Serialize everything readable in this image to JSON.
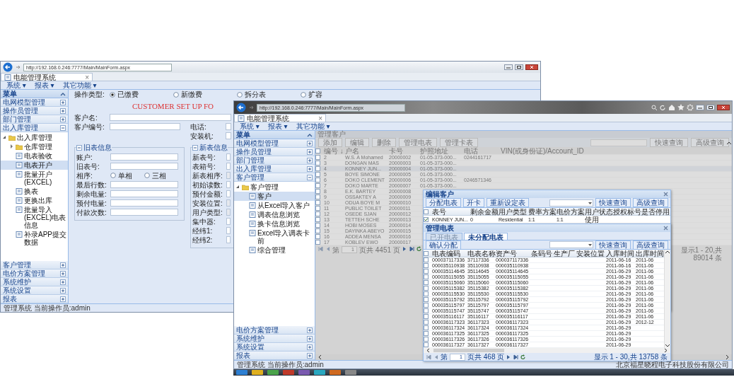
{
  "window_1": {
    "url": "http://192.168.0.246:7777/Main/MainForm.aspx",
    "tab": "电能管理系统",
    "tab_close": "×",
    "menu": [
      "系统 ▾",
      "报表 ▾",
      "其它功能 ▾"
    ],
    "sidebar": {
      "title": "菜单",
      "sections": [
        {
          "label": "电网模型管理",
          "expanded": false
        },
        {
          "label": "操作员管理",
          "expanded": false
        },
        {
          "label": "部门管理",
          "expanded": false
        },
        {
          "label": "出入库管理",
          "expanded": true,
          "tree": [
            {
              "label": "出入库管理",
              "kind": "folder",
              "expanded": true,
              "children": [
                {
                  "label": "仓库管理",
                  "kind": "folder",
                  "expanded": false
                },
                {
                  "label": "电表验收",
                  "kind": "page",
                  "selected": false
                },
                {
                  "label": "电表开户",
                  "kind": "page",
                  "selected": true
                },
                {
                  "label": "批量开户(EXCEL)",
                  "kind": "page",
                  "selected": false
                },
                {
                  "label": "换表",
                  "kind": "page",
                  "selected": false
                },
                {
                  "label": "更换出库",
                  "kind": "page",
                  "selected": false
                },
                {
                  "label": "批量导入(EXCEL)电表信息",
                  "kind": "page",
                  "selected": false
                },
                {
                  "label": "补录APP提交数据",
                  "kind": "page",
                  "selected": false
                }
              ]
            }
          ]
        },
        {
          "label": "客户管理",
          "expanded": false
        },
        {
          "label": "电价方案管理",
          "expanded": false
        },
        {
          "label": "系统维护",
          "expanded": false
        },
        {
          "label": "系统设置",
          "expanded": false
        },
        {
          "label": "报表",
          "expanded": false
        }
      ]
    },
    "status_bar": "管理系统  当前操作员:admin",
    "form": {
      "operation": {
        "label": "操作类型:",
        "options": [
          {
            "label": "已缴费",
            "selected": true
          },
          {
            "label": "新缴费",
            "selected": false
          },
          {
            "label": "拆分表",
            "selected": false
          },
          {
            "label": "扩容",
            "selected": false
          }
        ]
      },
      "title": "CUSTOMER SET UP FO",
      "customer_name": "客户名:",
      "customer_no": "客户编号:",
      "phone": "电话:",
      "installer": "安装机:",
      "old_meter": {
        "legend": "旧表信息",
        "expanded": true,
        "rows": [
          {
            "kind": "field",
            "label": "账户:"
          },
          {
            "kind": "field",
            "label": "旧表号:"
          },
          {
            "kind": "radio",
            "label": "相序:",
            "options": [
              {
                "label": "单相",
                "selected": false
              },
              {
                "label": "三相",
                "selected": false
              }
            ]
          },
          {
            "kind": "field",
            "label": "最后行数:"
          },
          {
            "kind": "field",
            "label": "剩余电量:"
          },
          {
            "kind": "field",
            "label": "预付电量:"
          },
          {
            "kind": "field",
            "label": "付款次数:"
          }
        ]
      },
      "new_meter": {
        "legend": "新表信息",
        "expanded": true,
        "rows": [
          {
            "kind": "field",
            "label": "新表号:"
          },
          {
            "kind": "field",
            "label": "表箱号:"
          },
          {
            "kind": "combo",
            "label": "新表相序:"
          },
          {
            "kind": "field",
            "label": "初始读数:"
          },
          {
            "kind": "field",
            "label": "预付金额:"
          },
          {
            "kind": "combo",
            "label": "安装位置:"
          },
          {
            "kind": "combo",
            "label": "用户类型:"
          },
          {
            "kind": "field",
            "label": "集中器:"
          },
          {
            "kind": "field",
            "label": "经纬1:"
          },
          {
            "kind": "field",
            "label": "经纬2:"
          }
        ]
      }
    }
  },
  "window_2": {
    "url": "http://192.168.0.246:7777/Main/MainForm.aspx",
    "tab": "电能管理系统",
    "tab_close": "×",
    "menu": [
      "系统 ▾",
      "报表 ▾",
      "其它功能 ▾"
    ],
    "sidebar": {
      "title": "菜单",
      "sections": [
        {
          "label": "电网模型管理",
          "expanded": false
        },
        {
          "label": "操作员管理",
          "expanded": false
        },
        {
          "label": "部门管理",
          "expanded": false
        },
        {
          "label": "出入库管理",
          "expanded": false
        },
        {
          "label": "客户管理",
          "expanded": true,
          "tree": [
            {
              "label": "客户管理",
              "kind": "folder",
              "expanded": true,
              "children": [
                {
                  "label": "客户",
                  "kind": "page",
                  "selected": true
                },
                {
                  "label": "从Excel导入客户",
                  "kind": "page",
                  "selected": false
                },
                {
                  "label": "调表信息浏览",
                  "kind": "page",
                  "selected": false
                },
                {
                  "label": "换卡信息浏览",
                  "kind": "page",
                  "selected": false
                },
                {
                  "label": "Excel导入调表卡前",
                  "kind": "page",
                  "selected": false
                },
                {
                  "label": "综合管理",
                  "kind": "page",
                  "selected": false
                }
              ]
            }
          ]
        },
        {
          "label": "电价方案管理",
          "expanded": false
        },
        {
          "label": "系统维护",
          "expanded": false
        },
        {
          "label": "系统设置",
          "expanded": false
        },
        {
          "label": "报表",
          "expanded": false
        }
      ]
    },
    "status_bar": "管理系统  当前操作员:admin",
    "company": "北京福星晓程电子科技股份有限公司",
    "customers": {
      "title": "管理客户",
      "toolbar": [
        "添加",
        "编辑",
        "删除",
        "管理电表",
        "管理卡表"
      ],
      "search_buttons": [
        "快速查询",
        "高级查询"
      ],
      "columns": [
        "编号 ↓",
        "户名",
        "卡号",
        "护照地址",
        "电话",
        "VIN(或身份证)/Account_ID"
      ],
      "rows": [
        {
          "selected": false,
          "cells": [
            "2",
            "W.S. A Mohamed",
            "20000002",
            "01-05-373-000...",
            "0244161717"
          ]
        },
        {
          "selected": false,
          "cells": [
            "3",
            "DONGAN MAS",
            "20000003",
            "01-05-373-000..."
          ]
        },
        {
          "selected": true,
          "cells": [
            "4",
            "KONNEY JUN...",
            "20000004",
            "01-05-373-000..."
          ]
        },
        {
          "selected": false,
          "cells": [
            "5",
            "BOYE SIMONE",
            "20000005",
            "01-05-373-000..."
          ]
        },
        {
          "selected": false,
          "cells": [
            "6",
            "DOKO CLEMENT",
            "20000006",
            "01-05-373-000...",
            "0246571346"
          ]
        },
        {
          "selected": false,
          "cells": [
            "7",
            "DOKO MARTE",
            "20000007",
            "01-05-373-000..."
          ]
        },
        {
          "selected": false,
          "cells": [
            "8",
            "E.K. BARTEY",
            "20000008"
          ]
        },
        {
          "selected": false,
          "cells": [
            "9",
            "OSSAKTEY A",
            "20000009"
          ]
        },
        {
          "selected": false,
          "cells": [
            "10",
            "ODUA BOYE M",
            "20000010"
          ]
        },
        {
          "selected": false,
          "cells": [
            "11",
            "PUBLIC TOILET",
            "20000011"
          ]
        },
        {
          "selected": false,
          "cells": [
            "12",
            "OSEDE SJAN",
            "20000012"
          ]
        },
        {
          "selected": false,
          "cells": [
            "13",
            "TETTEH SCHE",
            "20000013"
          ]
        },
        {
          "selected": false,
          "cells": [
            "14",
            "HOBI MOSES",
            "20000014"
          ]
        },
        {
          "selected": false,
          "cells": [
            "15",
            "DAYINKA ABEYO",
            "20000015"
          ]
        },
        {
          "selected": false,
          "cells": [
            "16",
            "ADDEA MENSA",
            "20000016"
          ]
        },
        {
          "selected": false,
          "cells": [
            "17",
            "KOBLEV EWO",
            "20000017"
          ]
        }
      ],
      "pager": {
        "page_label": "第",
        "page": "1",
        "page_total": "页共 4451 页"
      },
      "summary": "显示1 - 20,共 89014 条"
    }
  },
  "edit_customer_dialog": {
    "title": "编辑客户",
    "toolbar": [
      "分配电表",
      "开卡",
      "重新设定表"
    ],
    "search_buttons": [
      "快速查询",
      "高级查询"
    ],
    "columns": [
      "表号",
      "剩余金额",
      "用户类型",
      "费率方案",
      "电价方案",
      "用户状态",
      "授权标号",
      "是否停用"
    ],
    "rows": [
      {
        "checked": true,
        "cells": [
          "KONNEY JUN...",
          "0",
          "Residential",
          "1:1",
          "1:1",
          "使用"
        ]
      }
    ]
  },
  "meter_dialog": {
    "title": "管理电表",
    "tabs": [
      {
        "label": "已开电表",
        "selected": false
      },
      {
        "label": "未分配电表",
        "selected": true
      }
    ],
    "assign_button": "确认分配",
    "search_buttons": [
      "快速查询",
      "高级查询"
    ],
    "columns": [
      "电表编码",
      "电表名称",
      "资产号",
      "条码号",
      "生产厂",
      "安装位置",
      "入库时间",
      "出库时间"
    ],
    "rows": [
      {
        "checked": false,
        "code": "000037117336",
        "name": "37117336",
        "asset": "000037117336",
        "in_date": "2011-06-16",
        "out_date": "2011-06"
      },
      {
        "checked": false,
        "code": "000035110938",
        "name": "35110938",
        "asset": "000035110938",
        "in_date": "2011-06-16",
        "out_date": "2011-06"
      },
      {
        "checked": false,
        "code": "000035114645",
        "name": "35114645",
        "asset": "000035114645",
        "in_date": "2011-06-29",
        "out_date": "2011-06"
      },
      {
        "checked": false,
        "code": "000035115055",
        "name": "35115055",
        "asset": "000035115055",
        "in_date": "2011-06-29",
        "out_date": "2011-06"
      },
      {
        "checked": false,
        "code": "000035115060",
        "name": "35115060",
        "asset": "000035115060",
        "in_date": "2011-06-29",
        "out_date": "2011-06"
      },
      {
        "checked": false,
        "code": "000035115382",
        "name": "35115382",
        "asset": "000035115382",
        "in_date": "2011-06-29",
        "out_date": "2011-06"
      },
      {
        "checked": false,
        "code": "000035115530",
        "name": "35115530",
        "asset": "000035115530",
        "in_date": "2011-06-29",
        "out_date": "2011-06"
      },
      {
        "checked": false,
        "code": "000035115792",
        "name": "35115792",
        "asset": "000035115792",
        "in_date": "2011-06-29",
        "out_date": "2011-06"
      },
      {
        "checked": false,
        "code": "000035115797",
        "name": "35115797",
        "asset": "000035115797",
        "in_date": "2011-06-29",
        "out_date": "2011-06"
      },
      {
        "checked": false,
        "code": "000035115747",
        "name": "35115747",
        "asset": "000035115747",
        "in_date": "2011-06-29",
        "out_date": "2011-06"
      },
      {
        "checked": false,
        "code": "000035116117",
        "name": "35116117",
        "asset": "000035116117",
        "in_date": "2011-06-29",
        "out_date": "2011-06"
      },
      {
        "checked": false,
        "code": "000036117323",
        "name": "36117323",
        "asset": "000036117323",
        "in_date": "2011-06-29",
        "out_date": "2012-12"
      },
      {
        "checked": false,
        "code": "000036117324",
        "name": "36117324",
        "asset": "000036117324",
        "in_date": "2011-06-29"
      },
      {
        "checked": false,
        "code": "000036117325",
        "name": "36117325",
        "asset": "000036117325",
        "in_date": "2011-06-29"
      },
      {
        "checked": false,
        "code": "000036117326",
        "name": "36117326",
        "asset": "000036117326",
        "in_date": "2011-06-29"
      },
      {
        "checked": false,
        "code": "000036117327",
        "name": "36117327",
        "asset": "000036117327",
        "in_date": "2011-06-29"
      }
    ],
    "pager": {
      "page_label": "第",
      "page": "1",
      "page_total": "页共 468 页"
    },
    "summary": "显示 1 - 30,共 13758 条"
  }
}
